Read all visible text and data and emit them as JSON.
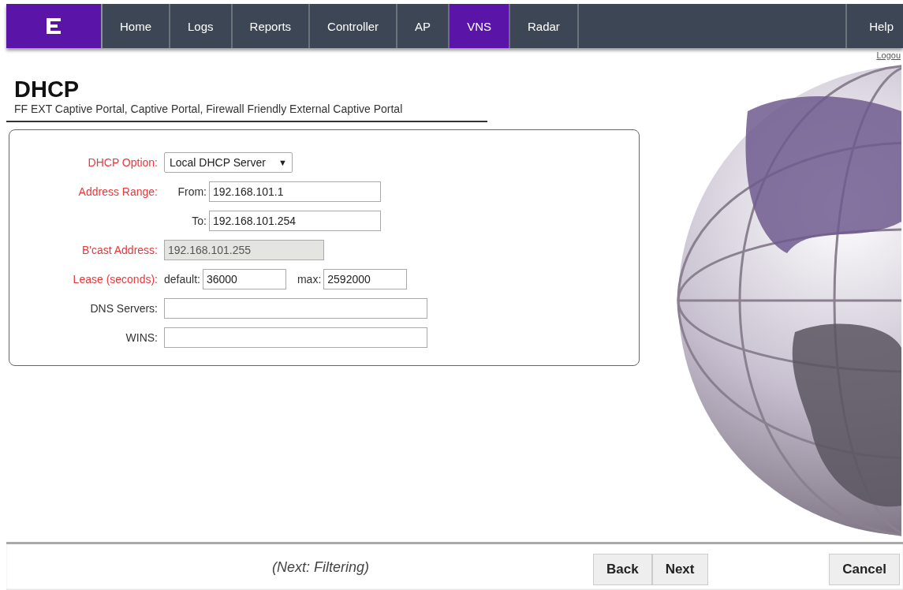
{
  "nav": {
    "tabs": [
      {
        "label": "Home",
        "selected": false
      },
      {
        "label": "Logs",
        "selected": false
      },
      {
        "label": "Reports",
        "selected": false
      },
      {
        "label": "Controller",
        "selected": false
      },
      {
        "label": "AP",
        "selected": false
      },
      {
        "label": "VNS",
        "selected": true
      },
      {
        "label": "Radar",
        "selected": false
      }
    ],
    "help": "Help"
  },
  "logout": "Logou",
  "page": {
    "title": "DHCP",
    "subtitle": "FF EXT Captive Portal, Captive Portal, Firewall Friendly External Captive Portal"
  },
  "form": [
    {
      "kind": "select",
      "label": "DHCP Option:",
      "required": true,
      "value": "Local DHCP Server",
      "caret": "▼"
    },
    {
      "kind": "pair",
      "label": "Address Range:",
      "required": true,
      "sublabel": "From:",
      "value": "192.168.101.1"
    },
    {
      "kind": "pair",
      "sublabel": "To:",
      "value": "192.168.101.254"
    },
    {
      "kind": "text",
      "label": "B'cast Address:",
      "required": true,
      "disabled": true,
      "value": "192.168.101.255"
    },
    {
      "kind": "lease",
      "label": "Lease (seconds):",
      "required": true,
      "fields": [
        {
          "label": "default:",
          "value": "36000"
        },
        {
          "label": "max:",
          "value": "2592000"
        }
      ]
    },
    {
      "kind": "text",
      "label": "DNS Servers:",
      "required": false,
      "disabled": false
    },
    {
      "kind": "text",
      "label": "WINS:",
      "required": false,
      "disabled": false
    }
  ],
  "footer": {
    "next_hint": "(Next: Filtering)",
    "buttons": [
      "Back",
      "Next"
    ],
    "cancel": "Cancel"
  }
}
